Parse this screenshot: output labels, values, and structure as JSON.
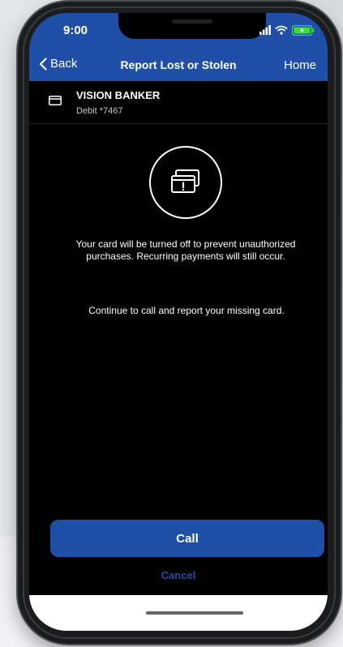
{
  "status_bar": {
    "time": "9:00",
    "icons": [
      "signal-icon",
      "wifi-icon",
      "battery-charging-icon"
    ]
  },
  "nav": {
    "back_label": "Back",
    "title": "Report Lost or Stolen",
    "home_label": "Home"
  },
  "account": {
    "name": "VISION BANKER",
    "detail": "Debit *7467",
    "icon": "card-icon"
  },
  "message": {
    "icon": "card-alert-icon",
    "primary": "Your card will be turned off to prevent unauthorized purchases. Recurring payments will still occur.",
    "secondary": "Continue to call and report your missing card."
  },
  "actions": {
    "call_label": "Call",
    "cancel_label": "Cancel"
  },
  "colors": {
    "brand_blue": "#1f4fa6",
    "screen_background": "#000000",
    "text": "#ffffff",
    "battery_charge": "#3ddc3a"
  }
}
